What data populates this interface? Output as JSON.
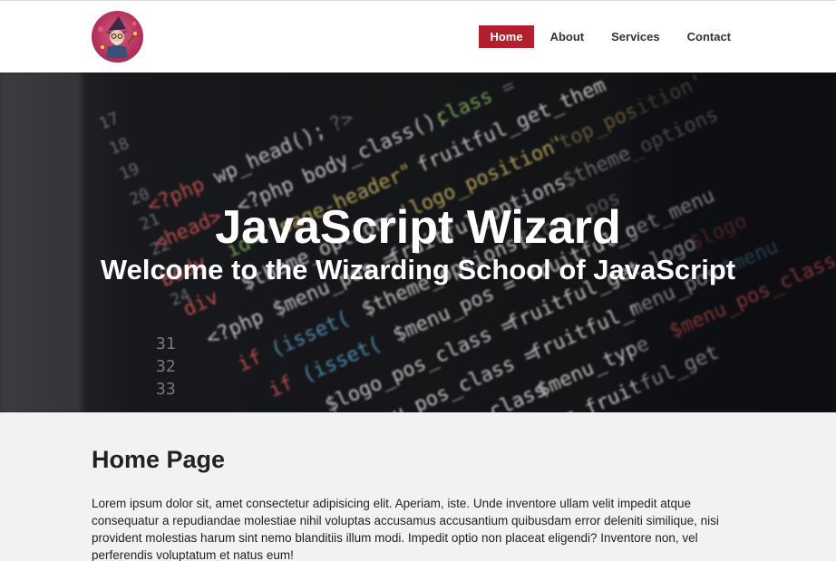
{
  "header": {
    "logo_icon": "wizard-logo",
    "nav": [
      {
        "label": "Home",
        "active": true
      },
      {
        "label": "About",
        "active": false
      },
      {
        "label": "Services",
        "active": false
      },
      {
        "label": "Contact",
        "active": false
      }
    ]
  },
  "hero": {
    "title": "JavaScript Wizard",
    "subtitle": "Welcome to the Wizarding School of JavaScript",
    "background": "code-editor-photo"
  },
  "main": {
    "heading": "Home Page",
    "body": "Lorem ipsum dolor sit, amet consectetur adipisicing elit. Aperiam, iste. Unde inventore ullam velit impedit atque consequatur a repudiandae molestiae nihil voluptas accusamus accusantium quibusdam error deleniti similique, nisi provident molestias harum sint nemo blanditiis illum modi. Impedit optio non placeat eligendi? Inventore non, vel perferendis voluptatum et natus eum!"
  },
  "colors": {
    "accent": "#b21f2d",
    "hero_bg": "#1b1c1f",
    "page_bg": "#f2f2f2"
  }
}
